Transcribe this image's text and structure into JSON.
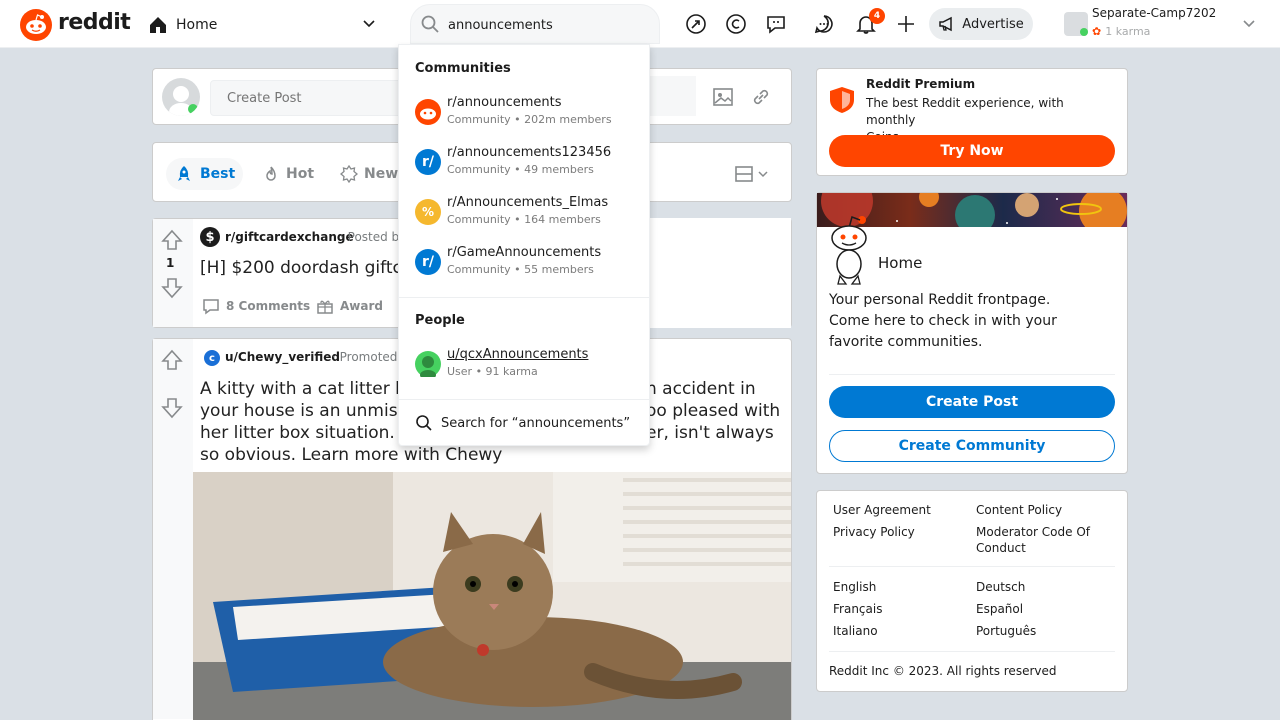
{
  "header": {
    "logo_text": "reddit",
    "home_label": "Home",
    "search_value": "announcements",
    "notification_count": "4",
    "advertise_label": "Advertise",
    "username": "Separate-Camp7202",
    "karma": "1 karma"
  },
  "create_post": {
    "placeholder": "Create Post"
  },
  "sort": {
    "best": "Best",
    "hot": "Hot",
    "new": "New"
  },
  "posts": [
    {
      "subreddit": "r/giftcardexchange",
      "posted_by": "· Posted by",
      "vote": "1",
      "title": "[H] $200 doordash giftc",
      "comments": "8 Comments",
      "award": "Award"
    },
    {
      "author": "u/Chewy_verified",
      "promoted": "· Promoted",
      "title_lines": [
        "A kitty with a cat litter b",
        "your house is an unmista",
        "her litter box situation. I",
        "so obvious. Learn more with Chewy"
      ],
      "title_right_lines": [
        "h accident in",
        "oo pleased with",
        "er, isn't always"
      ]
    }
  ],
  "dropdown": {
    "communities_heading": "Communities",
    "communities": [
      {
        "name": "r/announcements",
        "sub": "Community • 202m members"
      },
      {
        "name": "r/announcements123456",
        "sub": "Community • 49 members"
      },
      {
        "name": "r/Announcements_Elmas",
        "sub": "Community • 164 members"
      },
      {
        "name": "r/GameAnnouncements",
        "sub": "Community • 55 members"
      }
    ],
    "people_heading": "People",
    "people": [
      {
        "name": "u/qcxAnnouncements",
        "sub": "User • 91 karma"
      }
    ],
    "search_for": "Search for “announcements”"
  },
  "sidebar": {
    "premium_title": "Reddit Premium",
    "premium_sub": "The best Reddit experience, with monthly",
    "premium_coins": "Coins",
    "try_now": "Try Now",
    "home_title": "Home",
    "home_text": "Your personal Reddit frontpage. Come here to check in with your favorite communities.",
    "create_post": "Create Post",
    "create_community": "Create Community"
  },
  "footer": {
    "user_agreement": "User Agreement",
    "content_policy": "Content Policy",
    "privacy_policy": "Privacy Policy",
    "moderator_code": "Moderator Code Of",
    "moderator_code_2": "Conduct",
    "english": "English",
    "deutsch": "Deutsch",
    "francais": "Français",
    "espanol": "Español",
    "italiano": "Italiano",
    "portugues": "Português",
    "copyright": "Reddit Inc © 2023. All rights reserved"
  },
  "colors": {
    "brand": "#ff4500",
    "blue": "#0079d3",
    "background": "#dae0e6"
  }
}
